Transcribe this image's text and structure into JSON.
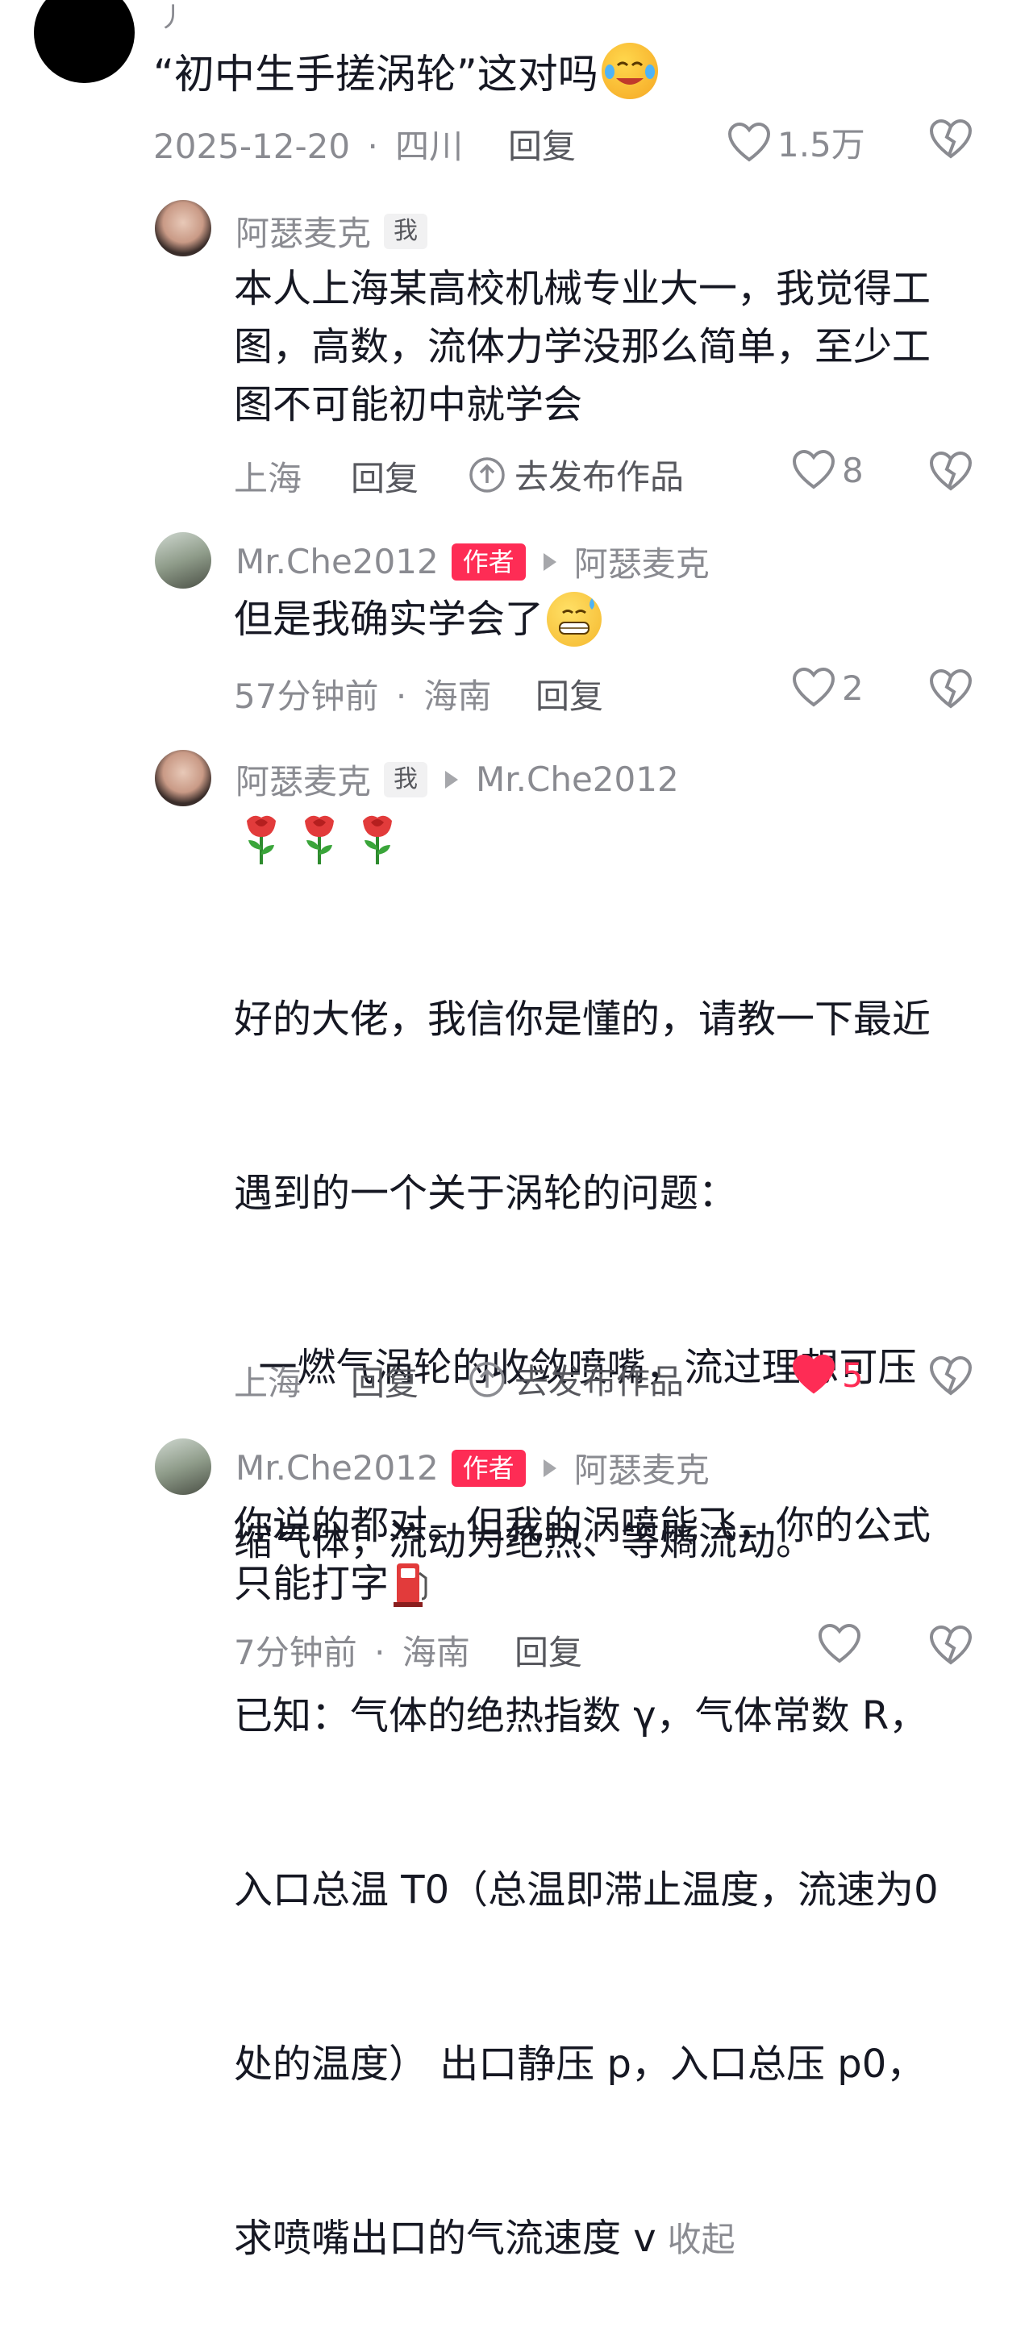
{
  "top_comment": {
    "text": "“初中生手搓涡轮”这对吗",
    "date": "2025-12-20",
    "sep": "·",
    "location": "四川",
    "reply": "回复",
    "likes": "1.5万"
  },
  "replies": [
    {
      "name": "阿瑟麦克",
      "tag": "我",
      "target": "",
      "lines": [
        "本人上海某高校机械专业大一，我觉得工",
        "图，高数，流体力学没那么简单，至少工",
        "图不可能初中就学会"
      ],
      "time": "",
      "location": "上海",
      "reply": "回复",
      "publish": "去发布作品",
      "likes": "8",
      "liked": false
    },
    {
      "name": "Mr.Che2012",
      "tag": "作者",
      "target": "阿瑟麦克",
      "lines": [
        "但是我确实学会了"
      ],
      "time": "57分钟前",
      "location": "海南",
      "reply": "回复",
      "publish": "",
      "likes": "2",
      "liked": false
    },
    {
      "name": "阿瑟麦克",
      "tag": "我",
      "target": "Mr.Che2012",
      "lines": [
        "好的大佬，我信你是懂的，请教一下最近",
        "遇到的一个关于涡轮的问题：",
        "  一燃气涡轮的收敛喷嘴，流过理想可压",
        "缩气体，流动为绝热、等熵流动。",
        "已知：气体的绝热指数 γ，气体常数 R，",
        "入口总温 T0（总温即滞止温度，流速为0",
        "处的温度） 出口静压 p，入口总压 p0，",
        "求喷嘴出口的气流速度 v"
      ],
      "collapse": "收起",
      "time": "",
      "location": "上海",
      "reply": "回复",
      "publish": "去发布作品",
      "likes": "5",
      "liked": true
    },
    {
      "name": "Mr.Che2012",
      "tag": "作者",
      "target": "阿瑟麦克",
      "lines": [
        "你说的都对。但我的涡喷能飞，你的公式",
        "只能打字"
      ],
      "time": "7分钟前",
      "location": "海南",
      "reply": "回复",
      "publish": "",
      "likes": "",
      "liked": false
    }
  ],
  "colors": {
    "accent": "#fe2c55",
    "meta_gray": "#8a8b91",
    "text": "#161823"
  }
}
